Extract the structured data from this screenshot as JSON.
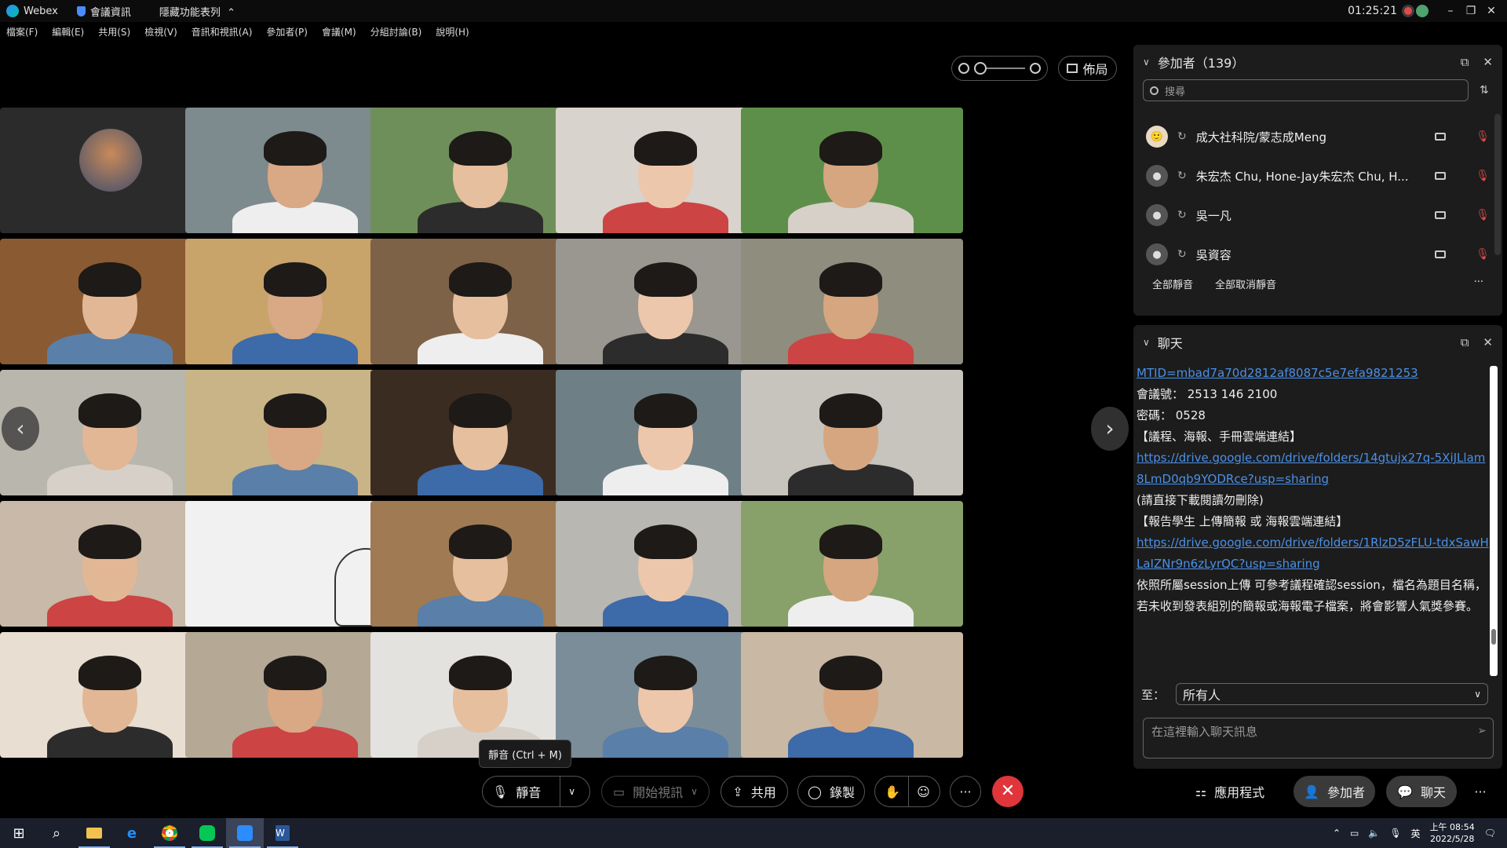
{
  "titlebar": {
    "app_name": "Webex",
    "meeting_info": "會議資訊",
    "hide_menu": "隱藏功能表列",
    "clock": "01:25:21"
  },
  "menu": [
    "檔案(F)",
    "編輯(E)",
    "共用(S)",
    "檢視(V)",
    "音訊和視訊(A)",
    "參加者(P)",
    "會議(M)",
    "分組討論(B)",
    "說明(H)"
  ],
  "layout_label": "佈局",
  "participants_panel": {
    "title": "參加者（139）",
    "search_placeholder": "搜尋",
    "items": [
      {
        "name": "成大社科院/蒙志成Meng",
        "avatar": "photo"
      },
      {
        "name": "朱宏杰 Chu, Hone-Jay朱宏杰 Chu, H...",
        "avatar": "person"
      },
      {
        "name": "吳一凡",
        "avatar": "person"
      },
      {
        "name": "吳資容",
        "avatar": "person"
      }
    ],
    "mute_all": "全部靜音",
    "unmute_all": "全部取消靜音"
  },
  "chat_panel": {
    "title": "聊天",
    "messages": [
      {
        "type": "link",
        "text": "MTID=mbad7a70d2812af8087c5e7efa9821253"
      },
      {
        "type": "text",
        "text": "會議號： 2513 146 2100"
      },
      {
        "type": "text",
        "text": "密碼： 0528"
      },
      {
        "type": "text",
        "text": "【議程、海報、手冊雲端連結】"
      },
      {
        "type": "link",
        "text": "https://drive.google.com/drive/folders/14gtujx27q-5XiJLlam8LmD0qb9YODRce?usp=sharing"
      },
      {
        "type": "text",
        "text": "(請直接下載閱讀勿刪除)"
      },
      {
        "type": "text",
        "text": "【報告學生 上傳簡報 或 海報雲端連結】"
      },
      {
        "type": "link",
        "text": "https://drive.google.com/drive/folders/1RlzD5zFLU-tdxSawHLaIZNr9n6zLyrQC?usp=sharing"
      },
      {
        "type": "text",
        "text": "依照所屬session上傳 可參考議程確認session，檔名為題目名稱，若未收到發表組別的簡報或海報電子檔案，將會影響人氣獎參賽。"
      }
    ],
    "to_label": "至：",
    "to_value": "所有人",
    "input_placeholder": "在這裡輸入聊天訊息"
  },
  "tooltip": "靜音 (Ctrl + M)",
  "toolbar": {
    "mute": "靜音",
    "start_video": "開始視訊",
    "share": "共用",
    "record": "錄製",
    "apps": "應用程式",
    "participants": "參加者",
    "chat": "聊天"
  },
  "taskbar": {
    "ime": "英",
    "time": "上午 08:54",
    "date": "2022/5/28"
  },
  "colors": {
    "end_button": "#e0353b",
    "link": "#4a90e8",
    "muted_mic": "#e04b4b"
  }
}
